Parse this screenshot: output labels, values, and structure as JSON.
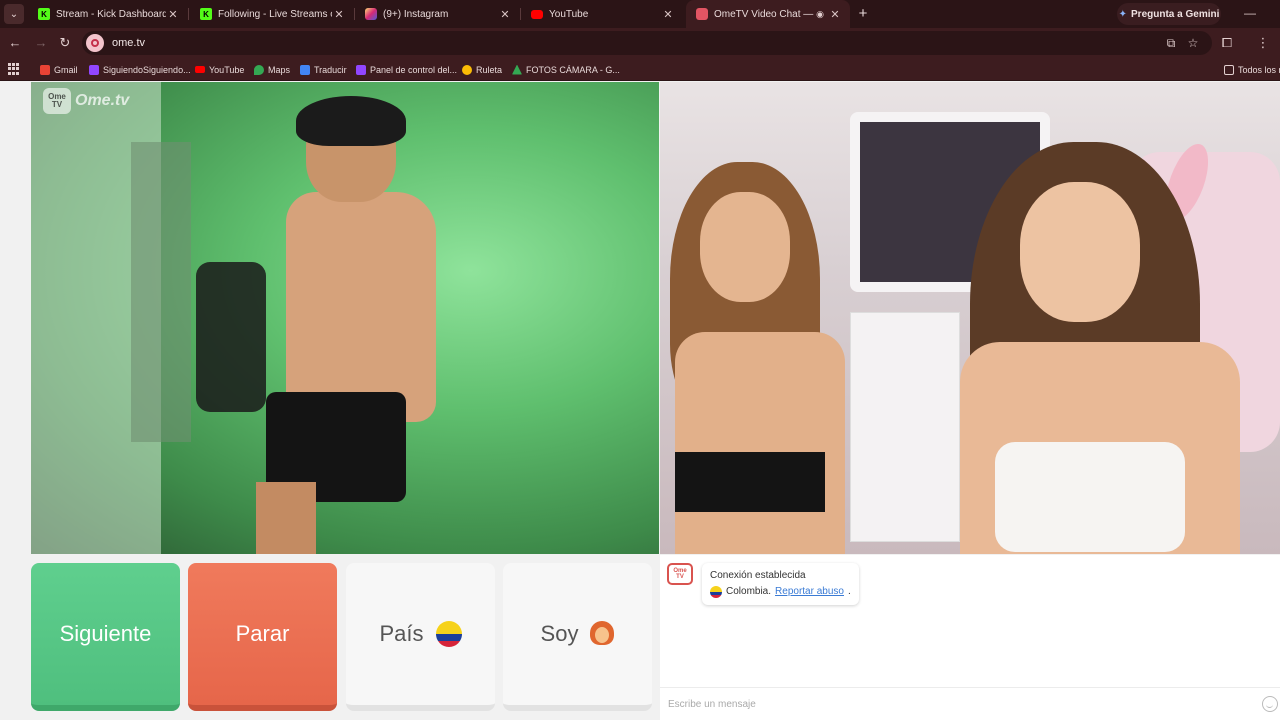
{
  "browser": {
    "tabs": [
      {
        "title": "Stream - Kick Dashboard",
        "favicon": "kick-icon",
        "color": "#53fc18"
      },
      {
        "title": "Following - Live Streams on Kick",
        "favicon": "kick-icon",
        "color": "#53fc18"
      },
      {
        "title": "(9+) Instagram",
        "favicon": "instagram-icon",
        "color": "#e1306c"
      },
      {
        "title": "YouTube",
        "favicon": "youtube-icon",
        "color": "#ff0000"
      },
      {
        "title": "OmeTV Video Chat — OmeTV",
        "favicon": "ometv-icon",
        "color": "#e25563",
        "active": true
      }
    ],
    "gemini_label": "Pregunta a Gemini",
    "url": "ome.tv",
    "bookmarks": [
      {
        "label": "Gmail",
        "color": "#ea4335"
      },
      {
        "label": "SiguiendoSiguiendo...",
        "color": "#9146ff"
      },
      {
        "label": "YouTube",
        "color": "#ff0000"
      },
      {
        "label": "Maps",
        "color": "#34a853"
      },
      {
        "label": "Traducir",
        "color": "#4285f4"
      },
      {
        "label": "Panel de control del...",
        "color": "#9146ff"
      },
      {
        "label": "Ruleta",
        "color": "#fbbc05"
      },
      {
        "label": "FOTOS CÁMARA - G...",
        "color": "#34a853"
      }
    ],
    "all_bookmarks_label": "Todos los m"
  },
  "video": {
    "logo_small": "Ome TV",
    "watermark": "Ome.tv"
  },
  "controls": {
    "next_label": "Siguiente",
    "stop_label": "Parar",
    "country_label": "País",
    "gender_label": "Soy"
  },
  "chat": {
    "status": "Conexión establecida",
    "country": "Colombia.",
    "report_link": "Reportar abuso",
    "report_suffix": ".",
    "input_placeholder": "Escribe un mensaje",
    "logo": "Ome TV"
  },
  "colors": {
    "next": "#5fcf8e",
    "stop": "#f07a5c",
    "chrome": "#3d1c1f"
  }
}
